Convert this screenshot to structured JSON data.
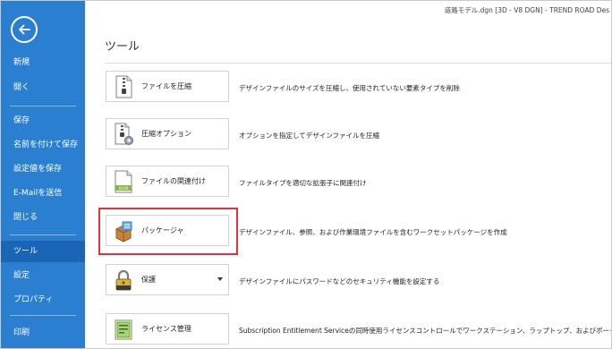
{
  "window": {
    "title": "道路モデル.dgn [3D - V8 DGN] - TREND ROAD Des"
  },
  "sidebar": {
    "back_icon": "back-arrow-icon",
    "items": [
      {
        "label": "新規"
      },
      {
        "label": "開く"
      },
      {
        "label": "保存"
      },
      {
        "label": "名前を付けて保存"
      },
      {
        "label": "設定値を保存"
      },
      {
        "label": "E-Mailを送信"
      },
      {
        "label": "閉じる"
      },
      {
        "label": "ツール",
        "active": true
      },
      {
        "label": "設定"
      },
      {
        "label": "プロパティ"
      },
      {
        "label": "印刷"
      }
    ]
  },
  "main": {
    "title": "ツール",
    "tools": [
      {
        "label": "ファイルを圧縮",
        "icon": "zipper-file-icon",
        "description": "デザインファイルのサイズを圧縮し、使用されていない要素タイプを削除"
      },
      {
        "label": "圧縮オプション",
        "icon": "compress-options-icon",
        "description": "オプションを指定してデザインファイルを圧縮"
      },
      {
        "label": "ファイルの関連付け",
        "icon": "file-association-icon",
        "icon_text": "DGN",
        "description": "ファイルタイプを適切な拡張子に関連付け"
      },
      {
        "label": "パッケージャ",
        "icon": "packager-icon",
        "description": "デザインファイル、参照、および作業環境ファイルを含むワークセットパッケージを作成",
        "highlighted": true
      },
      {
        "label": "保護",
        "icon": "padlock-icon",
        "has_dropdown": true,
        "description": "デザインファイルにパスワードなどのセキュリティ機能を設定する"
      },
      {
        "label": "ライセンス管理",
        "icon": "license-management-icon",
        "description": "Subscription Entitlement Serviceの同時使用ライセンスコントロールでワークステーション、ラップトップ、およびポータブルに対す"
      }
    ]
  },
  "colors": {
    "sidebar_bg": "#2b7fd0",
    "sidebar_active_bg": "#1a65b5",
    "highlight": "#e0343a"
  }
}
